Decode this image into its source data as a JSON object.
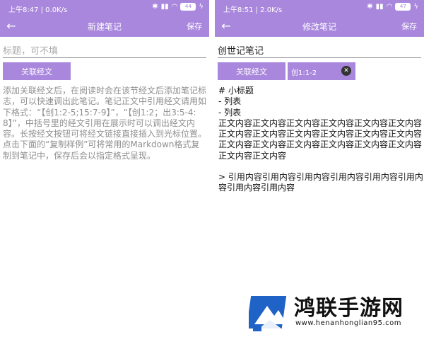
{
  "left": {
    "status": {
      "time": "上午8:47 | 0.0K/s",
      "battery": "44"
    },
    "appbar": {
      "title": "新建笔记",
      "save_label": "保存"
    },
    "title_placeholder": "标题，可不填",
    "link_button": "关联经文",
    "hint": "添加关联经文后，在阅读时会在该节经文后添加笔记标志，可以快速调出此笔记。笔记正文中引用经文请用如下格式：“【创1:2-5;15:7-9】”，“【创1:2；出3:5-4:8】”，中括号里的经文引用在展示时可以调出经文内容。长按经文按钮可将经文链接直接插入到光标位置。点击下面的“复制样例”可将常用的Markdown格式复制到笔记中，保存后会以指定格式呈现。"
  },
  "right": {
    "status": {
      "time": "上午8:51 | 2.0K/s",
      "battery": "47"
    },
    "appbar": {
      "title": "修改笔记",
      "save_label": "保存"
    },
    "title_value": "创世记笔记",
    "link_button": "关联经文",
    "ref_chip": "创1:1-2",
    "content": {
      "heading": "# 小标题",
      "item1": "- 列表",
      "item2": "- 列表",
      "body": "正文内容正文内容正文内容正文内容正文内容正文内容正文内容正文内容正文内容正文内容正文内容正文内容正文内容正文内容正文内容正文内容正文内容正文内容正文内容正文内容",
      "quote": "> 引用内容引用内容引用内容引用内容引用内容引用内容引用内容引用内容"
    }
  },
  "watermark": {
    "brand": "鸿联手游网",
    "url": "www.henanhonglian95.com"
  },
  "colors": {
    "accent": "#a987dd",
    "hint_text": "#8f8f8f",
    "divider": "#9a9a9a"
  }
}
